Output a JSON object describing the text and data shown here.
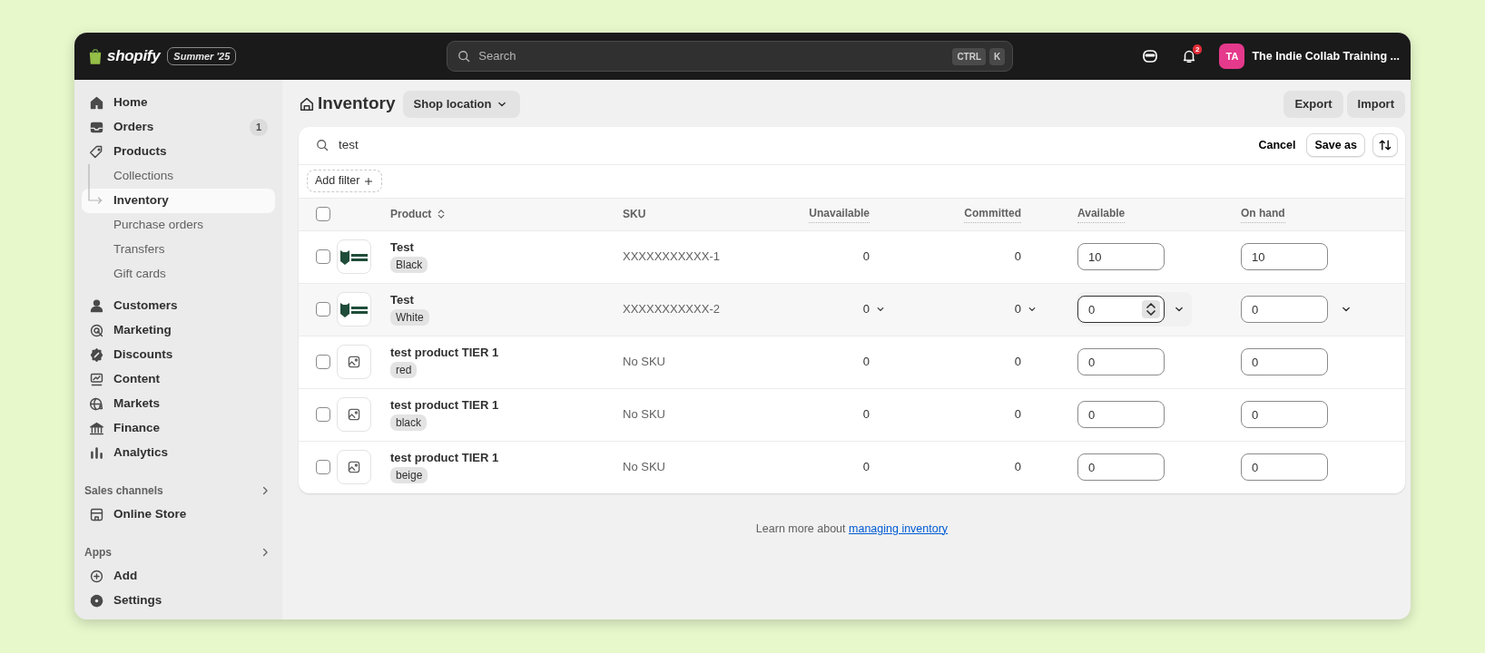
{
  "topbar": {
    "brand": "shopify",
    "edition": "Summer '25",
    "search": {
      "placeholder": "Search",
      "shortcut": [
        "CTRL",
        "K"
      ]
    },
    "notifications": "2",
    "avatar": "TA",
    "store": "The Indie Collab Training ..."
  },
  "sidebar": {
    "items": [
      {
        "label": "Home",
        "selected": false
      },
      {
        "label": "Orders",
        "badge": "1",
        "selected": false
      },
      {
        "label": "Products",
        "selected": false,
        "children": [
          {
            "label": "Collections",
            "selected": false
          },
          {
            "label": "Inventory",
            "selected": true
          },
          {
            "label": "Purchase orders",
            "selected": false
          },
          {
            "label": "Transfers",
            "selected": false
          },
          {
            "label": "Gift cards",
            "selected": false
          }
        ]
      },
      {
        "label": "Customers",
        "selected": false
      },
      {
        "label": "Marketing",
        "selected": false
      },
      {
        "label": "Discounts",
        "selected": false
      },
      {
        "label": "Content",
        "selected": false
      },
      {
        "label": "Markets",
        "selected": false
      },
      {
        "label": "Finance",
        "selected": false
      },
      {
        "label": "Analytics",
        "selected": false
      }
    ],
    "sections": [
      {
        "title": "Sales channels",
        "items": [
          {
            "label": "Online Store",
            "selected": false
          }
        ]
      },
      {
        "title": "Apps",
        "items": [
          {
            "label": "Add",
            "selected": false
          }
        ]
      }
    ],
    "bottom_items": [
      {
        "label": "Settings",
        "selected": false
      }
    ]
  },
  "page": {
    "title": "Inventory",
    "location_button": "Shop location",
    "actions": [
      "Export",
      "Import"
    ]
  },
  "filter_bar": {
    "query": "test",
    "cancel": "Cancel",
    "save": "Save as",
    "add_filter": "Add filter"
  },
  "table": {
    "all_checked": false,
    "columns": [
      {
        "label": "Product",
        "sortable": true,
        "hint": false
      },
      {
        "label": "SKU",
        "sortable": false,
        "hint": false
      },
      {
        "label": "Unavailable",
        "sortable": false,
        "hint": true
      },
      {
        "label": "Committed",
        "sortable": false,
        "hint": true
      },
      {
        "label": "Available",
        "sortable": false,
        "hint": true
      },
      {
        "label": "On hand",
        "sortable": false,
        "hint": true
      }
    ],
    "rows": [
      {
        "product": "Test",
        "variant": "Black",
        "image": true,
        "sku": "XXXXXXXXXXX-1",
        "unavailable": "0",
        "committed": "0",
        "available": "10",
        "on_hand": "10",
        "checked": false,
        "hovered": false,
        "available_focused": false
      },
      {
        "product": "Test",
        "variant": "White",
        "image": true,
        "sku": "XXXXXXXXXXX-2",
        "unavailable": "0",
        "committed": "0",
        "available": "0",
        "on_hand": "0",
        "checked": false,
        "hovered": true,
        "available_focused": true
      },
      {
        "product": "test product TIER 1",
        "variant": "red",
        "image": false,
        "sku": "No SKU",
        "unavailable": "0",
        "committed": "0",
        "available": "0",
        "on_hand": "0",
        "checked": false,
        "hovered": false,
        "available_focused": false
      },
      {
        "product": "test product TIER 1",
        "variant": "black",
        "image": false,
        "sku": "No SKU",
        "unavailable": "0",
        "committed": "0",
        "available": "0",
        "on_hand": "0",
        "checked": false,
        "hovered": false,
        "available_focused": false
      },
      {
        "product": "test product TIER 1",
        "variant": "beige",
        "image": false,
        "sku": "No SKU",
        "unavailable": "0",
        "committed": "0",
        "available": "0",
        "on_hand": "0",
        "checked": false,
        "hovered": false,
        "available_focused": false
      }
    ]
  },
  "footer": {
    "text": "Learn more about",
    "link": "managing inventory"
  }
}
